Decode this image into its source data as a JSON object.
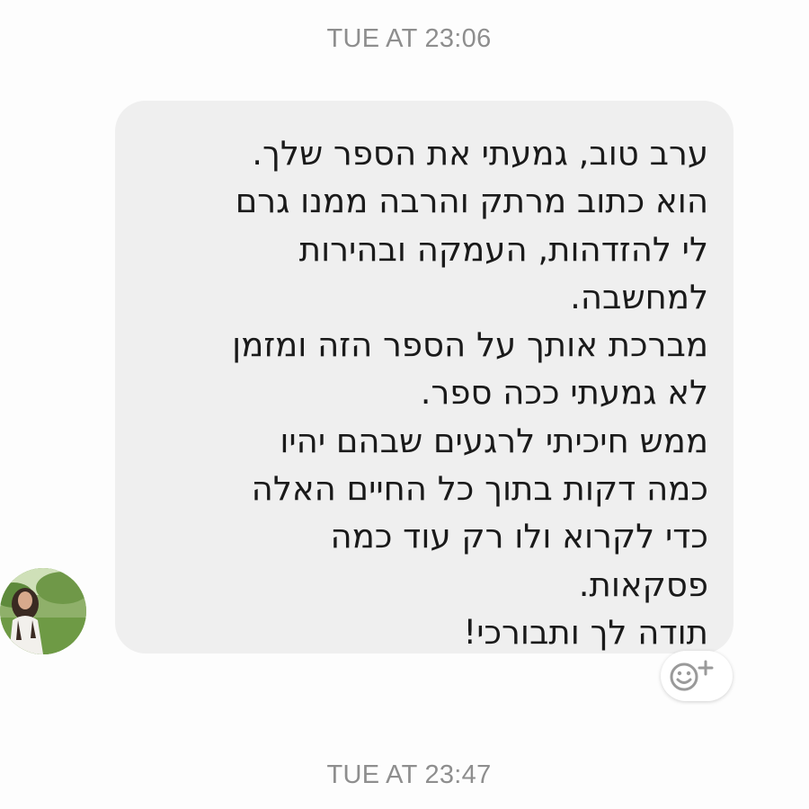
{
  "thread": {
    "timestamp_top": "TUE AT 23:06",
    "timestamp_bottom": "TUE AT 23:47"
  },
  "message": {
    "lines": [
      "ערב טוב, גמעתי את הספר שלך.",
      "הוא כתוב מרתק והרבה ממנו גרם",
      "לי להזדהות, העמקה ובהירות",
      "למחשבה.",
      "מברכת אותך על הספר הזה ומזמן",
      "לא גמעתי ככה ספר.",
      "ממש חיכיתי לרגעים שבהם יהיו",
      "כמה דקות בתוך כל החיים האלה",
      "כדי לקרוא ולו רק עוד כמה",
      "פסקאות.",
      "תודה לך ותבורכי!"
    ]
  },
  "icons": {
    "avatar": "contact-avatar",
    "reaction": "add-reaction-icon"
  },
  "colors": {
    "bubble_background": "#efefef",
    "timestamp_text": "#8e8e8e",
    "message_text": "#1a1a1a"
  }
}
